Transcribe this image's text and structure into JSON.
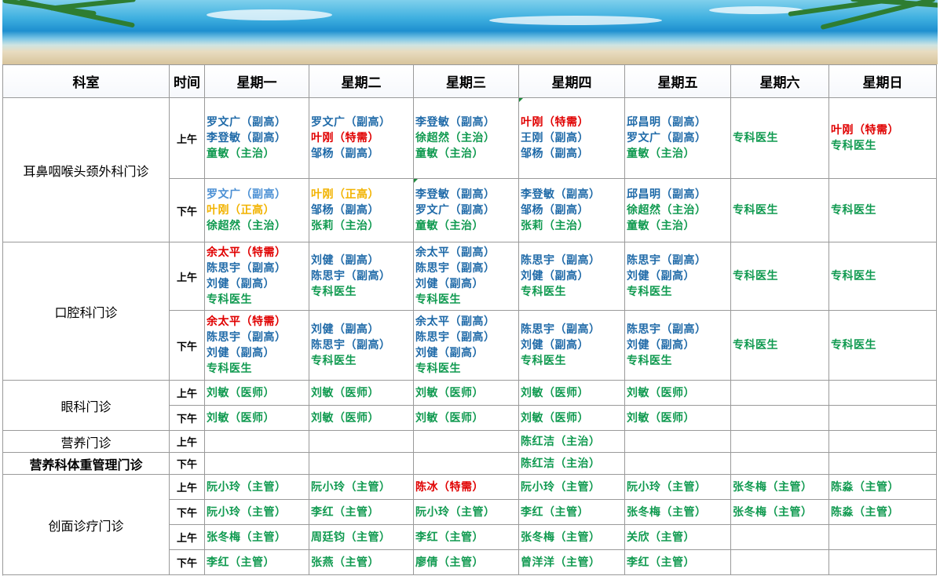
{
  "colors": {
    "green": "#109a50",
    "blue": "#1f6aa8",
    "red": "#e00000",
    "orange": "#f2b300",
    "light_blue": "#4a8fd4"
  },
  "header": {
    "dept": "科室",
    "time": "时间",
    "days": [
      "星期一",
      "星期二",
      "星期三",
      "星期四",
      "星期五",
      "星期六",
      "星期日"
    ]
  },
  "labels": {
    "am": "上午",
    "pm": "下午"
  },
  "ent": {
    "name": "耳鼻咽喉头颈外科门诊",
    "am": [
      [
        "罗文广（副高）",
        "李登敏（副高）",
        "童敏（主治）"
      ],
      [
        "罗文广（副高）",
        "叶刚（特需）",
        "邹杨（副高）"
      ],
      [
        "李登敏（副高）",
        "徐超然（主治）",
        "童敏（主治）"
      ],
      [
        "叶刚（特需）",
        "王刚（副高）",
        "邹杨（副高）"
      ],
      [
        "邱昌明（副高）",
        "罗文广（副高）",
        "童敏（主治）"
      ],
      [
        "专科医生"
      ],
      [
        "叶刚（特需）",
        "专科医生"
      ]
    ],
    "pm": [
      [
        "罗文广（副高）",
        "叶刚（正高）",
        "徐超然（主治）"
      ],
      [
        "叶刚（正高）",
        "邹杨（副高）",
        "张莉（主治）"
      ],
      [
        "李登敏（副高）",
        "罗文广（副高）",
        "童敏（主治）"
      ],
      [
        "李登敏（副高）",
        "邹杨（副高）",
        "张莉（主治）"
      ],
      [
        "邱昌明（副高）",
        "徐超然（主治）",
        "童敏（主治）"
      ],
      [
        "专科医生"
      ],
      [
        "专科医生"
      ]
    ]
  },
  "oral": {
    "name": "口腔科门诊",
    "am": [
      [
        "余太平（特需）",
        "陈思宇（副高）",
        "刘健（副高）",
        "专科医生"
      ],
      [
        "刘健（副高）",
        "陈思宇（副高）",
        "专科医生"
      ],
      [
        "余太平（副高）",
        "陈思宇（副高）",
        "刘健（副高）",
        "专科医生"
      ],
      [
        "陈思宇（副高）",
        "刘健（副高）",
        "专科医生"
      ],
      [
        "陈思宇（副高）",
        "刘健（副高）",
        "专科医生"
      ],
      [
        "专科医生"
      ],
      [
        "专科医生"
      ]
    ],
    "pm": [
      [
        "余太平（特需）",
        "陈思宇（副高）",
        "刘健（副高）",
        "专科医生"
      ],
      [
        "刘健（副高）",
        "陈思宇（副高）",
        "专科医生"
      ],
      [
        "余太平（副高）",
        "陈思宇（副高）",
        "刘健（副高）",
        "专科医生"
      ],
      [
        "陈思宇（副高）",
        "刘健（副高）",
        "专科医生"
      ],
      [
        "陈思宇（副高）",
        "刘健（副高）",
        "专科医生"
      ],
      [
        "专科医生"
      ],
      [
        "专科医生"
      ]
    ]
  },
  "eye": {
    "name": "眼科门诊",
    "am": [
      "刘敏（医师）",
      "刘敏（医师）",
      "刘敏（医师）",
      "刘敏（医师）",
      "刘敏（医师）",
      "",
      ""
    ],
    "pm": [
      "刘敏（医师）",
      "刘敏（医师）",
      "刘敏（医师）",
      "刘敏（医师）",
      "刘敏（医师）",
      "",
      ""
    ]
  },
  "nutrition": {
    "name": "营养门诊",
    "row": [
      "",
      "",
      "",
      "陈红洁（主治）",
      "",
      "",
      ""
    ]
  },
  "weight": {
    "name": "营养科体重管理门诊",
    "row": [
      "",
      "",
      "",
      "陈红洁（主治）",
      "",
      "",
      ""
    ]
  },
  "wound": {
    "name": "创面诊疗门诊",
    "r1": [
      "阮小玲（主管）",
      "阮小玲（主管）",
      "陈冰（特需）",
      "阮小玲（主管）",
      "阮小玲（主管）",
      "张冬梅（主管）",
      "陈淼（主管）"
    ],
    "r2": [
      "阮小玲（主管）",
      "李红（主管）",
      "阮小玲（主管）",
      "李红（主管）",
      "张冬梅（主管）",
      "张冬梅（主管）",
      "陈淼（主管）"
    ],
    "r3": [
      "张冬梅（主管）",
      "周廷钧（主管）",
      "李红（主管）",
      "张冬梅（主管）",
      "关欣（主管）",
      "",
      ""
    ],
    "r4": [
      "李红（主管）",
      "张燕（主管）",
      "廖倩（主管）",
      "曾洋洋（主管）",
      "李红（主管）",
      "",
      ""
    ]
  }
}
